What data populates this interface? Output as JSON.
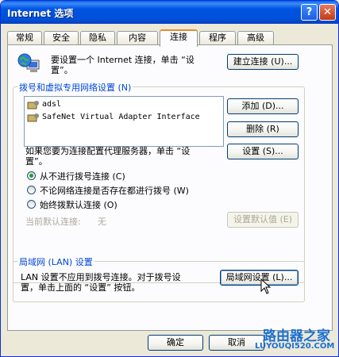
{
  "window": {
    "title": "Internet 选项"
  },
  "titlebar": {
    "help": "?",
    "close": "✕"
  },
  "tabs": [
    {
      "label": "常规"
    },
    {
      "label": "安全"
    },
    {
      "label": "隐私"
    },
    {
      "label": "内容"
    },
    {
      "label": "连接"
    },
    {
      "label": "程序"
    },
    {
      "label": "高级"
    }
  ],
  "active_tab": "连接",
  "setup": {
    "text_line1": "要设置一个 Internet 连接，单击 “设",
    "text_line2": "置”。",
    "button": "建立连接 (U)..."
  },
  "dialup": {
    "group_label": "拨号和虚拟专用网络设置 (N)",
    "connections": [
      {
        "name": "adsl"
      },
      {
        "name": "SafeNet Virtual Adapter Interface"
      }
    ],
    "add_button": "添加 (D)...",
    "delete_button": "删除 (R)",
    "settings_button": "设置 (S)...",
    "proxy_text_line1": "如果您要为连接配置代理服务器，单击 “设",
    "proxy_text_line2": "置”。",
    "options": [
      {
        "label": "从不进行拨号连接 (C)",
        "selected": true
      },
      {
        "label": "不论网络连接是否存在都进行拨号 (W)",
        "selected": false
      },
      {
        "label": "始终拨默认连接 (O)",
        "selected": false
      }
    ],
    "current_default_label": "当前默认连接:",
    "current_default_value": "无",
    "set_default_button": "设置默认值 (E)"
  },
  "lan": {
    "group_label": "局域网 (LAN) 设置",
    "text_line1": "LAN 设置不应用到拨号连接。对于拨号设",
    "text_line2": "置，单击上面的 “设置” 按钮。",
    "button": "局域网设置 (L)..."
  },
  "footer": {
    "ok": "确定",
    "cancel": "取消"
  },
  "watermark": {
    "text": "路由器之家",
    "url": "LUYOUQI520.COM"
  },
  "colors": {
    "title_bar": "#0054e3",
    "group_label": "#0046d5",
    "watermark": "#1a6fd1"
  }
}
